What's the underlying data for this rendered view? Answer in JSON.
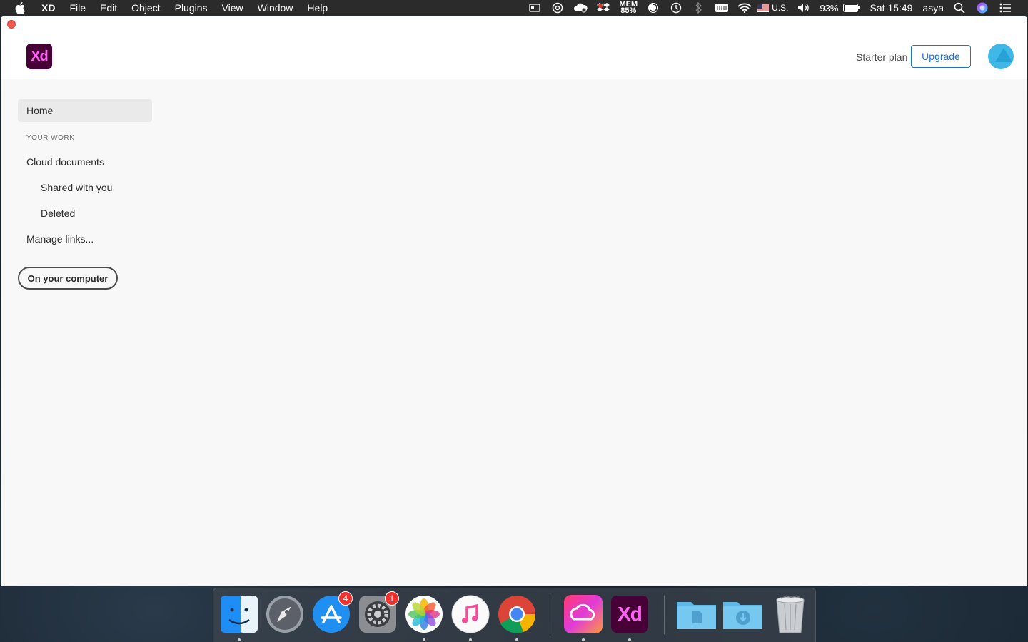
{
  "menubar": {
    "app_name": "XD",
    "items": [
      "File",
      "Edit",
      "Object",
      "Plugins",
      "View",
      "Window",
      "Help"
    ],
    "status": {
      "mem_label": "MEM",
      "mem_value": "85%",
      "keyboard": "U.S.",
      "battery": "93%",
      "clock": "Sat 15:49",
      "user": "asya"
    }
  },
  "header": {
    "logo_text": "Xd",
    "plan": "Starter plan",
    "upgrade_label": "Upgrade"
  },
  "sidebar": {
    "home": "Home",
    "section": "YOUR WORK",
    "cloud": "Cloud documents",
    "shared": "Shared with you",
    "deleted": "Deleted",
    "links": "Manage links...",
    "computer_button": "On your computer"
  },
  "dock": {
    "appstore_badge": "4",
    "prefs_badge": "1",
    "xd_label": "Xd"
  },
  "colors": {
    "accent": "#1473e6",
    "xd_bg": "#470137",
    "xd_fg": "#ff61f6",
    "close": "#ee5a52"
  }
}
